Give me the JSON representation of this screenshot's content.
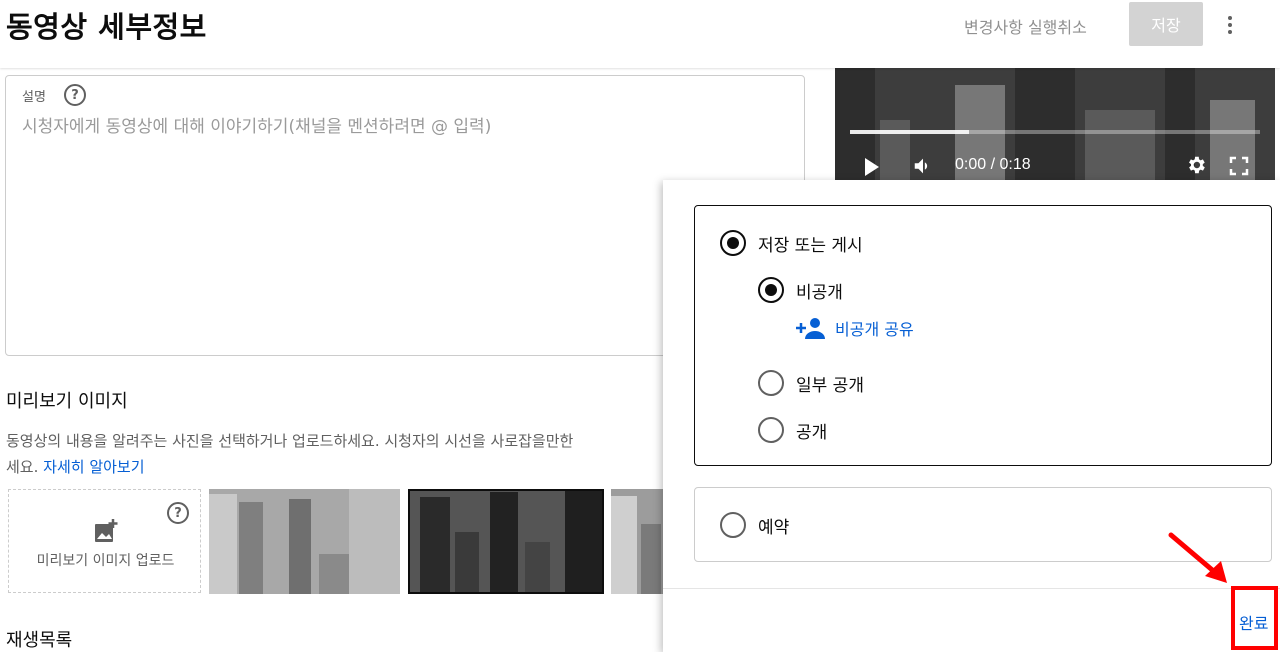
{
  "header": {
    "title": "동영상 세부정보",
    "undo_label": "변경사항 실행취소",
    "save_label": "저장"
  },
  "description": {
    "label": "설명",
    "placeholder": "시청자에게 동영상에 대해 이야기하기(채널을 멘션하려면 @ 입력)"
  },
  "video_player": {
    "time_display": "0:00 / 0:18",
    "progress": 0.29
  },
  "thumbnail": {
    "title": "미리보기 이미지",
    "description": "동영상의 내용을 알려주는 사진을 선택하거나 업로드하세요. 시청자의 시선을 사로잡을만한",
    "description_cont": "세요.",
    "learn_more": "자세히 알아보기",
    "upload_label": "미리보기 이미지 업로드"
  },
  "playlist": {
    "title": "재생목록"
  },
  "visibility_panel": {
    "save_or_publish": "저장 또는 게시",
    "private": "비공개",
    "share_private": "비공개 공유",
    "unlisted": "일부 공개",
    "public": "공개",
    "schedule": "예약",
    "done_label": "완료"
  },
  "colors": {
    "link": "#065fd4",
    "highlight": "#ff0000",
    "save_disabled": "#d3d3d3"
  }
}
